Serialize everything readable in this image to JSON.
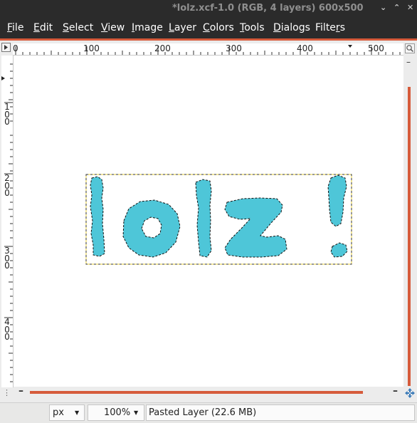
{
  "window": {
    "title": "*lolz.xcf-1.0 (RGB, 4 layers) 600x500",
    "minimize_glyph": "⌄",
    "maximize_glyph": "⌃",
    "close_glyph": "✕"
  },
  "menubar": {
    "items": [
      {
        "mnemonic": "F",
        "rest": "ile"
      },
      {
        "mnemonic": "E",
        "rest": "dit"
      },
      {
        "mnemonic": "S",
        "rest": "elect"
      },
      {
        "mnemonic": "V",
        "rest": "iew"
      },
      {
        "mnemonic": "I",
        "rest": "mage"
      },
      {
        "mnemonic": "L",
        "rest": "ayer"
      },
      {
        "mnemonic": "C",
        "rest": "olors"
      },
      {
        "mnemonic": "T",
        "rest": "ools"
      },
      {
        "mnemonic": "D",
        "rest": "ialogs"
      },
      {
        "pre": "Filte",
        "mnemonic": "r",
        "rest": "s"
      }
    ]
  },
  "rulers": {
    "horizontal": [
      "0",
      "100",
      "200",
      "300",
      "400",
      "500"
    ],
    "vertical": [
      [
        "1",
        "0",
        "0"
      ],
      [
        "2",
        "0",
        "0"
      ],
      [
        "3",
        "0",
        "0"
      ],
      [
        "4",
        "0",
        "0"
      ]
    ]
  },
  "canvas": {
    "text": "lolz !",
    "text_color": "#4ec6d8",
    "selection_color": "#000000",
    "layer_boundary_color": "#e8d23a"
  },
  "statusbar": {
    "unit": "px",
    "zoom": "100%",
    "message": "Pasted Layer (22.6 MB)"
  },
  "colors": {
    "titlebar_bg": "#2b2b2b",
    "accent": "#d65b3b",
    "canvas_bg": "#ffffff"
  }
}
